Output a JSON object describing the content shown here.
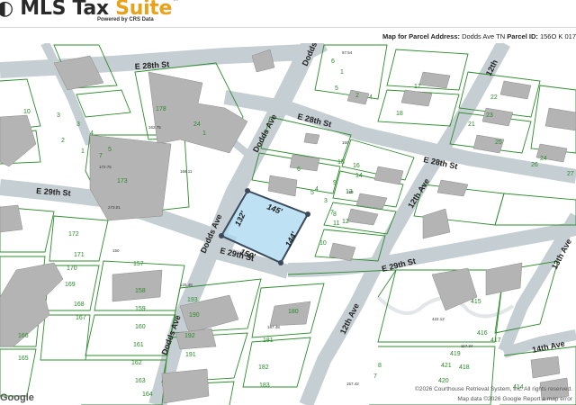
{
  "brand": {
    "name_prefix": "MLS Tax ",
    "name_accent": "Suite",
    "name_mark": "™",
    "tagline": "Powered by CRS Data",
    "logo_glyph": "◐"
  },
  "parcel": {
    "label": "Map for Parcel Address:",
    "address": "Dodds Ave TN",
    "id_label": "Parcel ID:",
    "id_value": "156O K 017"
  },
  "colors": {
    "road": "#c5ced3",
    "parcel_line": "#2e8b2e",
    "building": "#b4b4b4",
    "subject_fill": "#a8d8f0",
    "subject_stroke": "#3a4a5a"
  },
  "streets": {
    "e28_west": "E 28th St",
    "e28_east": "E 28th St",
    "e28_far": "E 28th St",
    "e29_west": "E 29th St",
    "e29_mid": "E 29th St",
    "e29_east": "E 29th St",
    "dodds_north": "Dodds Ave",
    "dodds_mid": "Dodds Ave",
    "dodds_south": "Dodds Ave",
    "dodds_top": "Dodds",
    "twelfth_north": "12th Ave",
    "twelfth_south": "12th Ave",
    "twelfth_top": "12th",
    "thirteenth": "13th Ave",
    "fourteenth": "14th Ave"
  },
  "dimensions": {
    "top": "145'",
    "left": "132'",
    "right": "144'",
    "bottom": "150'"
  },
  "lots": [
    "10",
    "3",
    "2",
    "1",
    "3",
    "4",
    "5",
    "7",
    "24",
    "1",
    "15",
    "16",
    "6",
    "5",
    "9",
    "4",
    "3",
    "7",
    "14",
    "13",
    "8",
    "12",
    "11",
    "10",
    "2",
    "18",
    "17",
    "22",
    "21",
    "23",
    "25",
    "26",
    "24",
    "27",
    "173",
    "172",
    "171",
    "170",
    "169",
    "168",
    "167",
    "166",
    "165",
    "157",
    "158",
    "159",
    "160",
    "161",
    "162",
    "163",
    "164",
    "180",
    "181",
    "182",
    "183",
    "190",
    "191",
    "192",
    "193",
    "178",
    "4",
    "1",
    "6",
    "5",
    "421",
    "420",
    "419",
    "418",
    "417",
    "416",
    "415",
    "8",
    "7",
    "414"
  ],
  "attribution": {
    "copyright": "©2026 Courthouse Retrieval System, Inc. All rights reserved.",
    "map_data": "Map data ©2026 Google  Report a map error",
    "google": "Google"
  }
}
